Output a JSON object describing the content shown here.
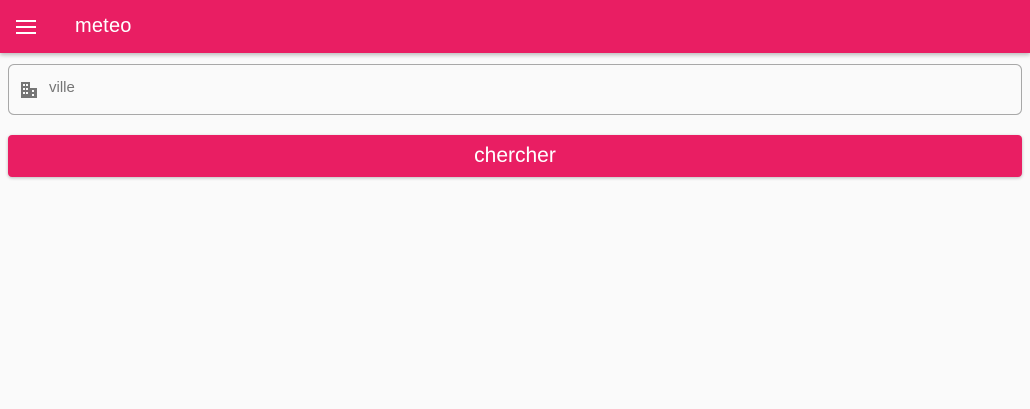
{
  "app_bar": {
    "title": "meteo",
    "menu_icon": "menu-icon",
    "background_color": "#e91e63",
    "text_color": "#ffffff"
  },
  "search": {
    "icon": "city-icon",
    "placeholder": "ville",
    "value": ""
  },
  "actions": {
    "search_label": "chercher",
    "button_color": "#e91e63"
  }
}
